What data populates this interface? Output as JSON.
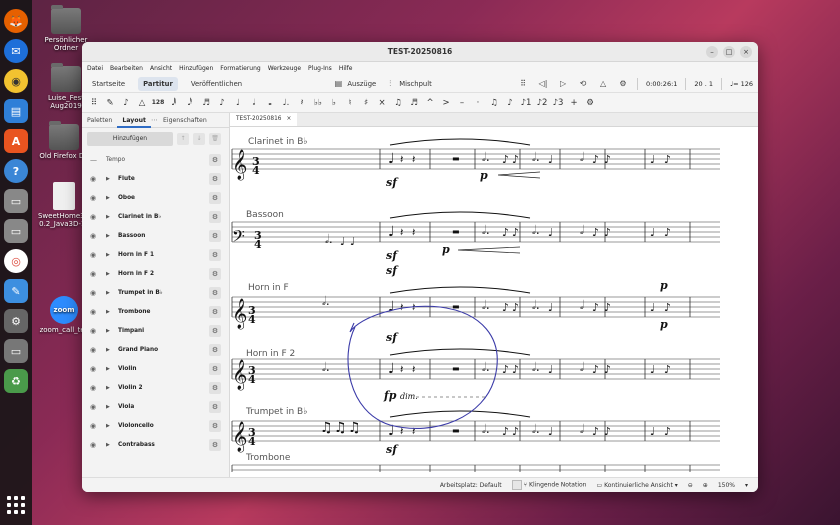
{
  "desktop": {
    "icons": [
      {
        "label": "Persönlicher Ordner"
      },
      {
        "label": "Luise_Fest Aug2019"
      },
      {
        "label": "Old Firefox Da"
      },
      {
        "label": "SweetHome3D 0.2_Java3D-1_"
      },
      {
        "label": "zoom_call_tes"
      }
    ]
  },
  "window": {
    "title": "TEST-20250816",
    "menus": [
      "Datei",
      "Bearbeiten",
      "Ansicht",
      "Hinzufügen",
      "Formatierung",
      "Werkzeuge",
      "Plug-Ins",
      "Hilfe"
    ],
    "workspace_tabs": [
      "Startseite",
      "Partitur",
      "Veröffentlichen"
    ],
    "toolbar": {
      "parts_label": "Auszüge",
      "mixer_label": "Mischpult",
      "time": "0:00:26:1",
      "position": "20 . 1",
      "tempo": "♩= 126"
    },
    "notebar": {
      "duration_128": "128"
    },
    "panel": {
      "tabs": [
        "Paletten",
        "Layout",
        "Eigenschaften"
      ],
      "add_button": "Hinzufügen",
      "tempo_label": "Tempo",
      "instruments": [
        "Flute",
        "Oboe",
        "Clarinet in B♭",
        "Bassoon",
        "Horn in F 1",
        "Horn in F 2",
        "Trumpet in B♭",
        "Trombone",
        "Timpani",
        "Grand Piano",
        "Violin",
        "Violin 2",
        "Viola",
        "Violoncello",
        "Contrabass"
      ]
    },
    "doc_tab": "TEST-20250816",
    "score": {
      "staff_labels": [
        "Clarinet in B♭",
        "Bassoon",
        "Horn in F",
        "Horn in F 2",
        "Trumpet in B♭",
        "Trombone"
      ],
      "dynamics": [
        "sf",
        "sf",
        "sf",
        "sf",
        "p",
        "p",
        "p",
        "p",
        "fp",
        "sf"
      ],
      "cresc_text": "dim."
    },
    "status": {
      "workspace": "Arbeitsplatz: Default",
      "concert_pitch": "Klingende Notation",
      "view_mode": "Kontinuierliche Ansicht",
      "zoom": "150%"
    }
  }
}
